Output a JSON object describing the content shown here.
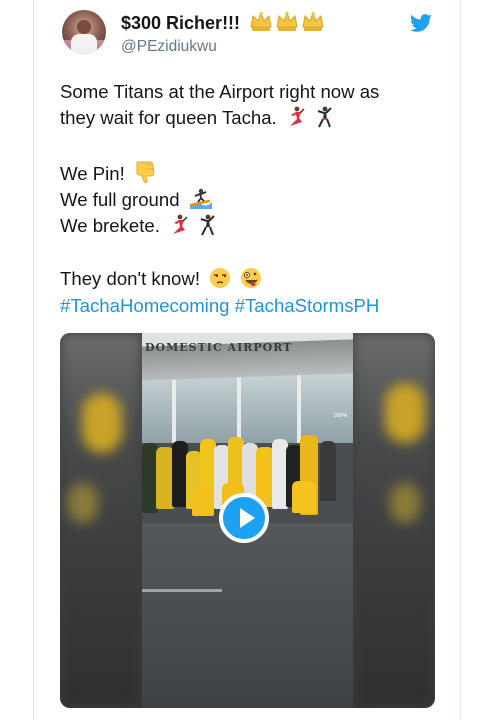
{
  "tweet": {
    "display_name": "$300 Richer!!!",
    "handle": "@PEzidiukwu",
    "lines": [
      "Some Titans at the Airport right now as",
      "they wait for queen Tacha.",
      "We Pin!",
      "We full ground",
      "We brekete.",
      "They don't know!"
    ],
    "hashtags": [
      "#TachaHomecoming",
      "#TachaStormsPH"
    ],
    "accent_color": "#1b95e0",
    "icons": [
      "crown-icon",
      "twitter-bird-icon",
      "dancer-icon",
      "man-dancing-icon",
      "thumbs-down-icon",
      "surfer-icon",
      "unamused-face-icon",
      "zany-face-icon",
      "play-icon"
    ]
  },
  "video": {
    "sign_text": "DOMESTIC AIRPORT",
    "door_text": "DEPA"
  }
}
